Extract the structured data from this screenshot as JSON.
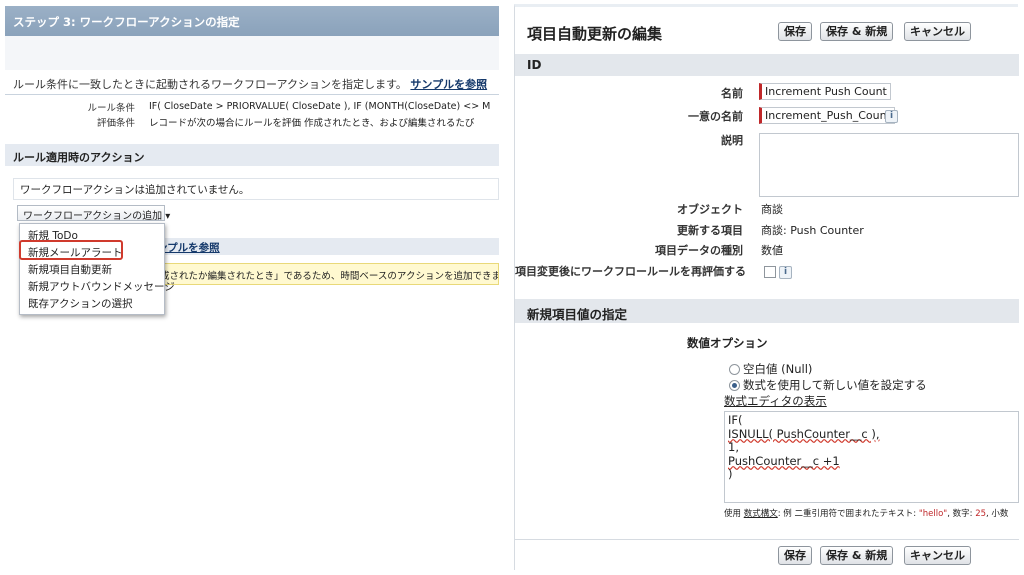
{
  "left": {
    "header": "ステップ 3: ワークフローアクションの指定",
    "description": "ルール条件に一致したときに起動されるワークフローアクションを指定します。",
    "sample_link": "サンプルを参照",
    "rule_label": "ルール条件",
    "rule_value": "IF( CloseDate > PRIORVALUE( CloseDate ), IF (MONTH(CloseDate) <> M",
    "eval_label": "評価条件",
    "eval_value": "レコードが次の場合にルールを評価 作成されたとき、および編集されるたび",
    "section_title": "ルール適用時のアクション",
    "no_actions": "ワークフローアクションは追加されていません。",
    "add_action": "ワークフローアクションの追加",
    "dropdown_arrow": "▾",
    "sample_link2": "ンプルを参照",
    "warning": "成されたか編集されたとき」であるため、時間ベースのアクションを追加できません。",
    "menu_items": [
      "新規 ToDo",
      "新規メールアラート",
      "新規項目自動更新",
      "新規アウトバウンドメッセージ",
      "既存アクションの選択"
    ]
  },
  "right": {
    "title": "項目自動更新の編集",
    "buttons": {
      "save": "保存",
      "save_new": "保存 & 新規",
      "cancel": "キャンセル"
    },
    "id_section": "ID",
    "name_label": "名前",
    "name_value": "Increment Push Count",
    "unique_label": "一意の名前",
    "unique_value": "Increment_Push_Count",
    "info_glyph": "i",
    "desc_label": "説明",
    "object_label": "オブジェクト",
    "object_value": "商談",
    "field_label": "更新する項目",
    "field_value": "商談: Push Counter",
    "datatype_label": "項目データの種別",
    "datatype_value": "数値",
    "reeval_label": "項目変更後にワークフロールールを再評価する",
    "new_value_section": "新規項目値の指定",
    "numeric_options": "数値オプション",
    "option_null": "空白値 (Null)",
    "option_formula": "数式を使用して新しい値を設定する",
    "formula_editor_link": "数式エディタの表示",
    "formula_lines": [
      "IF(",
      "ISNULL(  PushCounter__c  ),",
      "1,",
      "PushCounter__c +1",
      ")"
    ],
    "hint_use": "使用",
    "hint_syntax": "数式構文",
    "hint_text": ": 例 二重引用符で囲まれたテキスト: ",
    "hint_hello": "\"hello\"",
    "hint_number": ", 数字: ",
    "hint_25": "25",
    "hint_tail": ", 小数"
  }
}
